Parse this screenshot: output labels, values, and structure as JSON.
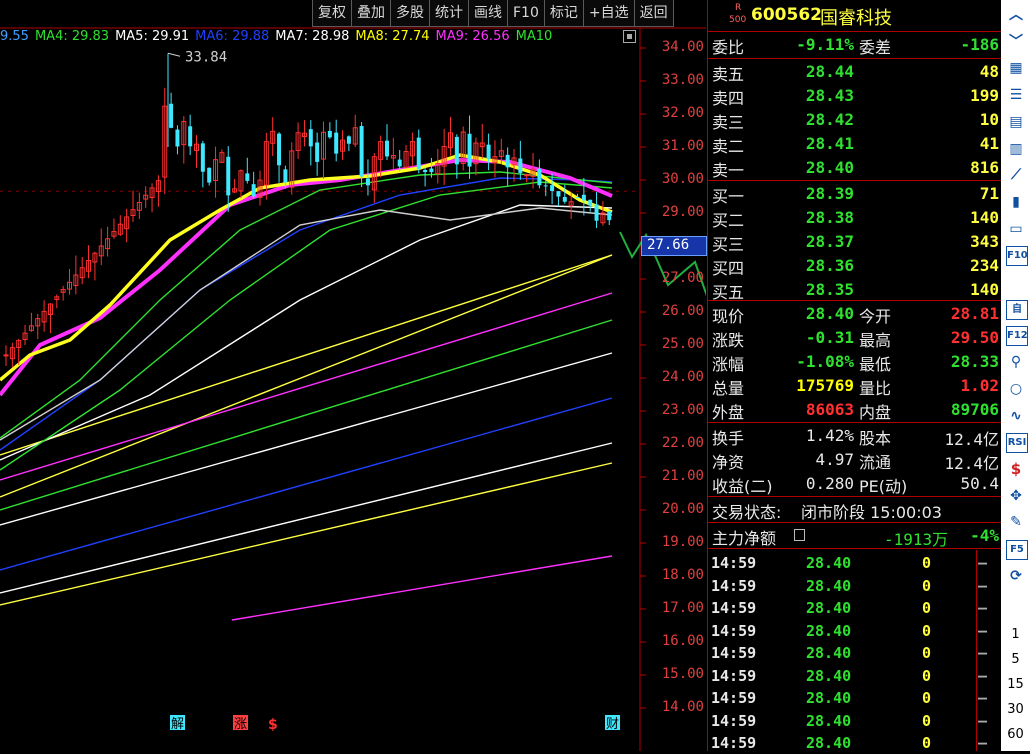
{
  "toolbar": [
    "复权",
    "叠加",
    "多股",
    "统计",
    "画线",
    "F10",
    "标记",
    "+自选",
    "返回"
  ],
  "ma_legend": [
    {
      "text": "9.55",
      "color": "#40a0ff"
    },
    {
      "text": "MA4: 29.83",
      "color": "#30e030"
    },
    {
      "text": "MA5: 29.91",
      "color": "#ffffff"
    },
    {
      "text": "MA6: 29.88",
      "color": "#2040ff"
    },
    {
      "text": "MA7: 28.98",
      "color": "#ffffff"
    },
    {
      "text": "MA8: 27.74",
      "color": "#ffff00"
    },
    {
      "text": "MA9: 26.56",
      "color": "#ff30ff"
    },
    {
      "text": "MA10",
      "color": "#30e030"
    }
  ],
  "chart_data": {
    "type": "candlestick",
    "price_axis": [
      "34.00",
      "33.00",
      "32.00",
      "31.00",
      "30.00",
      "29.00",
      "28.00",
      "27.00",
      "26.00",
      "25.00",
      "24.00",
      "23.00",
      "22.00",
      "21.00",
      "20.00",
      "19.00",
      "18.00",
      "17.00",
      "16.00",
      "15.00",
      "14.00"
    ],
    "high_annotation": "33.84",
    "current_price_tag": "27.66",
    "markers": [
      "解",
      "涨",
      "$",
      "财"
    ]
  },
  "stock": {
    "code_badge_top": "R",
    "code_badge_bottom": "500",
    "code": "600562",
    "name": "国睿科技"
  },
  "weibi": {
    "label": "委比",
    "value": "-9.11%",
    "label2": "委差",
    "value2": "-186"
  },
  "asks": [
    {
      "label": "卖五",
      "price": "28.44",
      "vol": "48"
    },
    {
      "label": "卖四",
      "price": "28.43",
      "vol": "199"
    },
    {
      "label": "卖三",
      "price": "28.42",
      "vol": "10"
    },
    {
      "label": "卖二",
      "price": "28.41",
      "vol": "41"
    },
    {
      "label": "卖一",
      "price": "28.40",
      "vol": "816"
    }
  ],
  "bids": [
    {
      "label": "买一",
      "price": "28.39",
      "vol": "71"
    },
    {
      "label": "买二",
      "price": "28.38",
      "vol": "140"
    },
    {
      "label": "买三",
      "price": "28.37",
      "vol": "343"
    },
    {
      "label": "买四",
      "price": "28.36",
      "vol": "234"
    },
    {
      "label": "买五",
      "price": "28.35",
      "vol": "140"
    }
  ],
  "quote": [
    {
      "l1": "现价",
      "v1": "28.40",
      "c1": "#30e030",
      "l2": "今开",
      "v2": "28.81",
      "c2": "#ff3030"
    },
    {
      "l1": "涨跌",
      "v1": "-0.31",
      "c1": "#30e030",
      "l2": "最高",
      "v2": "29.50",
      "c2": "#ff3030"
    },
    {
      "l1": "涨幅",
      "v1": "-1.08%",
      "c1": "#30e030",
      "l2": "最低",
      "v2": "28.33",
      "c2": "#30e030"
    },
    {
      "l1": "总量",
      "v1": "175769",
      "c1": "#ffff00",
      "l2": "量比",
      "v2": "1.02",
      "c2": "#ff3030"
    },
    {
      "l1": "外盘",
      "v1": "86063",
      "c1": "#ff3030",
      "l2": "内盘",
      "v2": "89706",
      "c2": "#30e030"
    }
  ],
  "fundamentals": [
    {
      "l1": "换手",
      "v1": "1.42%",
      "l2": "股本",
      "v2": "12.4亿"
    },
    {
      "l1": "净资",
      "v1": "4.97",
      "l2": "流通",
      "v2": "12.4亿"
    },
    {
      "l1": "收益(二)",
      "v1": "0.280",
      "l2": "PE(动)",
      "v2": "50.4"
    }
  ],
  "status": {
    "label": "交易状态:",
    "value": "闭市阶段 15:00:03"
  },
  "capital": {
    "label": "主力净额",
    "value": "-1913万",
    "pct": "-4%"
  },
  "ticks": [
    {
      "time": "14:59",
      "price": "28.40",
      "vol": "0",
      "dash": "–"
    },
    {
      "time": "14:59",
      "price": "28.40",
      "vol": "0",
      "dash": "–"
    },
    {
      "time": "14:59",
      "price": "28.40",
      "vol": "0",
      "dash": "–"
    },
    {
      "time": "14:59",
      "price": "28.40",
      "vol": "0",
      "dash": "–"
    },
    {
      "time": "14:59",
      "price": "28.40",
      "vol": "0",
      "dash": "–"
    },
    {
      "time": "14:59",
      "price": "28.40",
      "vol": "0",
      "dash": "–"
    },
    {
      "time": "14:59",
      "price": "28.40",
      "vol": "0",
      "dash": "–"
    },
    {
      "time": "14:59",
      "price": "28.40",
      "vol": "0",
      "dash": "–"
    },
    {
      "time": "14:59",
      "price": "28.40",
      "vol": "0",
      "dash": "–"
    }
  ],
  "sidebar": {
    "icons": [
      "chevron-up-icon",
      "chevron-down-icon",
      "calendar-icon",
      "list-icon",
      "table-icon",
      "grid-icon",
      "line-chart-icon",
      "candlestick-icon",
      "window-icon",
      "f10-icon",
      "report-icon",
      "self-select-icon",
      "f12-icon",
      "zoom-icon",
      "circle-icon",
      "wave-icon",
      "rsi-icon",
      "dollar-icon",
      "move-icon",
      "pencil-icon",
      "f5-icon",
      "refresh-icon"
    ],
    "labels": [
      "F10",
      "自",
      "F12",
      "RSI",
      "$",
      "F5"
    ],
    "periods": [
      "1",
      "5",
      "15",
      "30",
      "60"
    ]
  }
}
